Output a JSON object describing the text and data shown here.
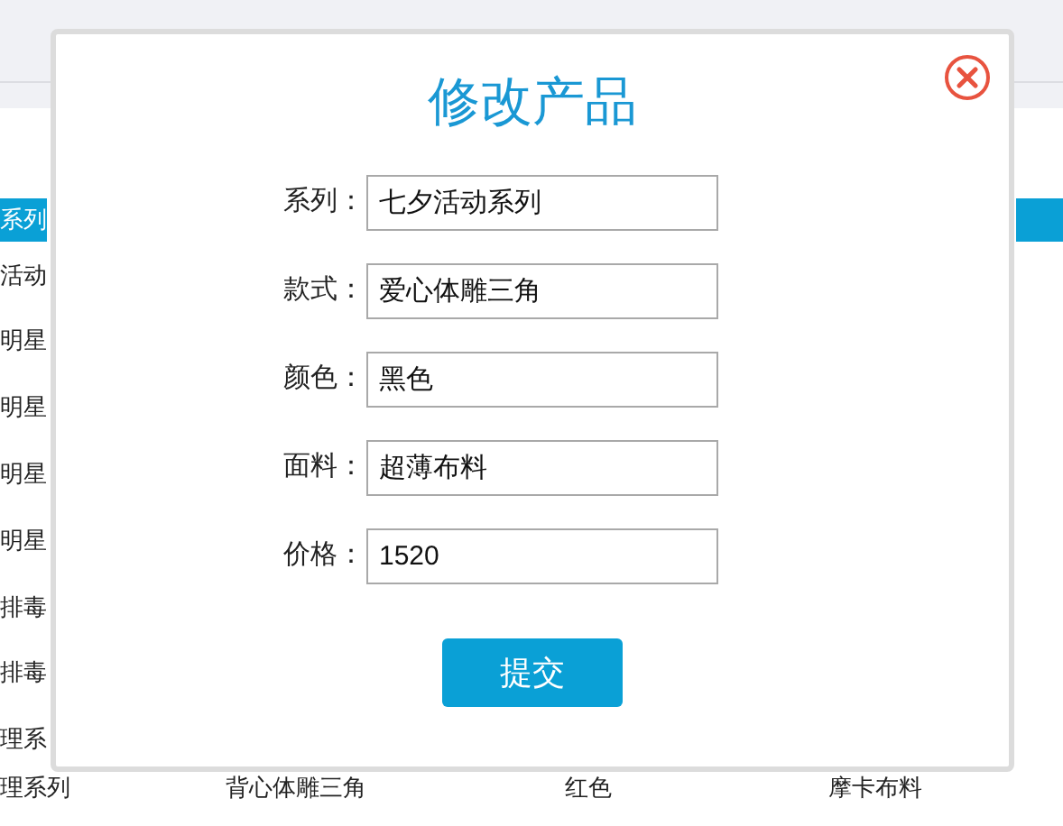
{
  "background_table": {
    "header": "系列",
    "column_1": [
      "活动",
      "明星",
      "明星",
      "明星",
      "明星",
      "排毒",
      "排毒",
      "理系"
    ],
    "last_row": [
      "理系列",
      "背心体雕三角",
      "红色",
      "摩卡布料"
    ]
  },
  "dialog": {
    "title": "修改产品",
    "fields": [
      {
        "label": "系列：",
        "value": "七夕活动系列"
      },
      {
        "label": "款式：",
        "value": "爱心体雕三角"
      },
      {
        "label": "颜色：",
        "value": "黑色"
      },
      {
        "label": "面料：",
        "value": "超薄布料"
      },
      {
        "label": "价格：",
        "value": "1520"
      }
    ],
    "submit": "提交"
  }
}
